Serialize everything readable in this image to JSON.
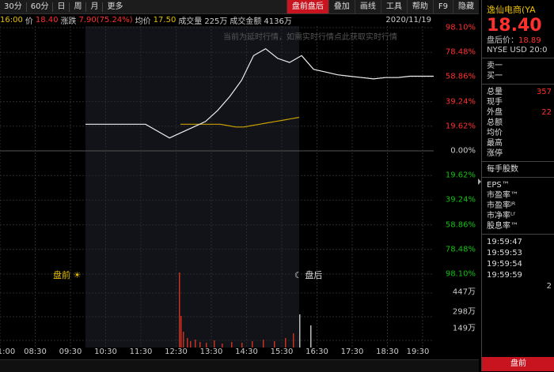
{
  "toolbar": {
    "periods": [
      "30分",
      "60分",
      "日",
      "周",
      "月",
      "更多"
    ],
    "buttons": [
      "盘前盘后",
      "叠加",
      "画线",
      "工具",
      "帮助",
      "F9",
      "隐藏"
    ],
    "active_button": "盘前盘后"
  },
  "info_bar": {
    "time": "16:00",
    "price_label": "价",
    "price": "18.40",
    "change_label": "涨跌",
    "change": "7.90(75.24%)",
    "avg_label": "均价",
    "avg": "17.50",
    "volume_label": "成交量",
    "volume": "225万",
    "amount_label": "成交金额",
    "amount": "4136万",
    "date": "2020/11/19"
  },
  "watermark": "当前为延时行情，如需实时行情点此获取实时行情",
  "y_axis_labels": [
    {
      "text": "98.10%",
      "color": "#ff3030"
    },
    {
      "text": "78.48%",
      "color": "#ff3030"
    },
    {
      "text": "58.86%",
      "color": "#ff3030"
    },
    {
      "text": "39.24%",
      "color": "#ff3030"
    },
    {
      "text": "19.62%",
      "color": "#ff3030"
    },
    {
      "text": "0.00%",
      "color": "#cccccc"
    },
    {
      "text": "19.62%",
      "color": "#10c010"
    },
    {
      "text": "39.24%",
      "color": "#10c010"
    },
    {
      "text": "58.86%",
      "color": "#10c010"
    },
    {
      "text": "78.48%",
      "color": "#10c010"
    },
    {
      "text": "98.10%",
      "color": "#10c010"
    }
  ],
  "volume_axis_labels": [
    "447万",
    "298万",
    "149万"
  ],
  "x_axis_labels": [
    "1:00",
    "08:30",
    "09:30",
    "10:30",
    "11:30",
    "12:30",
    "13:30",
    "14:30",
    "15:30",
    "16:30",
    "17:30",
    "18:30",
    "19:30"
  ],
  "session_labels": {
    "pre": "盘前",
    "post": "盘后"
  },
  "chart_data": {
    "type": "line",
    "series": [
      {
        "values": [
          0.4,
          0.4,
          0.4,
          0.4,
          0.4,
          0.4,
          0.35,
          0.3,
          0.34,
          0.38,
          0.42,
          0.5,
          0.6,
          0.72,
          0.9,
          0.95,
          0.88,
          0.85,
          0.9,
          0.8,
          0.78,
          0.76,
          0.75,
          0.74,
          0.73,
          0.74,
          0.74,
          0.75,
          0.75,
          0.75
        ]
      },
      {
        "values": [
          0.4,
          0.4,
          0.4,
          0.4,
          0.4,
          0.4,
          0.39,
          0.38,
          0.38,
          0.39,
          0.4,
          0.41,
          0.42,
          0.43,
          0.44,
          0.45
        ]
      }
    ]
  },
  "panel": {
    "title": "逸仙电商(YA",
    "price": "18.40",
    "prev_close_label": "盘后价：",
    "prev_close": "18.89",
    "exchange": "NYSE  USD  20:0",
    "sell1": "卖一",
    "buy1": "买一",
    "stats": [
      {
        "k": "总量",
        "v": "357"
      },
      {
        "k": "现手",
        "v": ""
      },
      {
        "k": "外盘",
        "v": "22"
      },
      {
        "k": "总额",
        "v": ""
      },
      {
        "k": "均价",
        "v": ""
      },
      {
        "k": "最高",
        "v": ""
      },
      {
        "k": "涨停",
        "v": ""
      }
    ],
    "per_share": "每手股数",
    "ratios": [
      "EPS™",
      "市盈率™",
      "市盈率ᴶᴿ",
      "市净率ᴸᶠ",
      "股息率™"
    ],
    "times": [
      "19:59:47",
      "19:59:53",
      "19:59:54",
      "19:59:59"
    ],
    "last_count": "2",
    "bottom_btn": "盘前"
  }
}
